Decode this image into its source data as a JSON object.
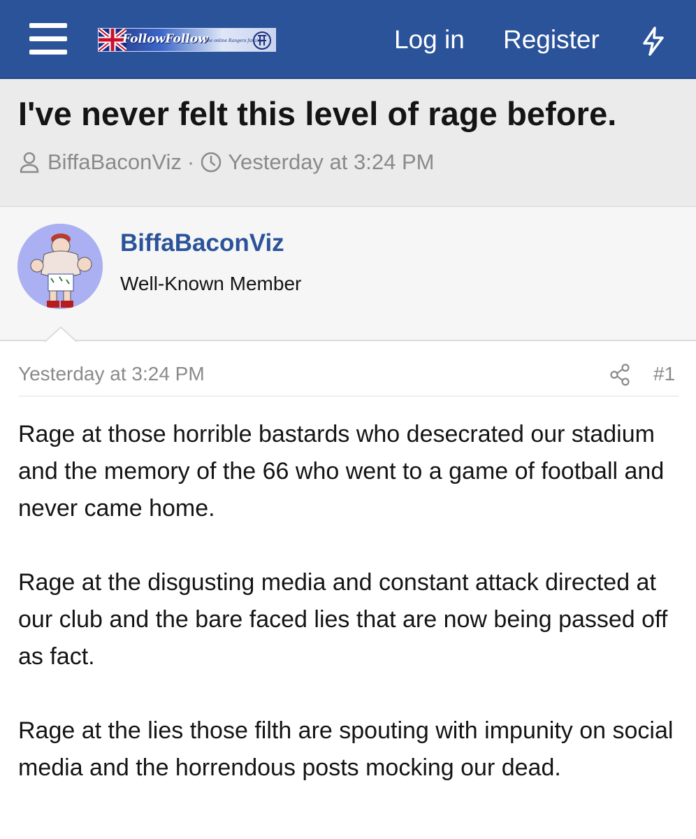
{
  "header": {
    "logo_text": "FollowFollow",
    "logo_tagline": "The online Rangers fanzine",
    "login_label": "Log in",
    "register_label": "Register",
    "icons": [
      "hamburger-menu-icon",
      "bolt-icon"
    ],
    "background_color": "#2b5399"
  },
  "thread": {
    "title": "I've never felt this level of rage before.",
    "author": "BiffaBaconViz",
    "separator": "·",
    "date": "Yesterday at 3:24 PM"
  },
  "author": {
    "name": "BiffaBaconViz",
    "title": "Well-Known Member",
    "name_color": "#2b5399"
  },
  "post": {
    "date": "Yesterday at 3:24 PM",
    "number": "#1",
    "paragraphs": [
      "Rage at those horrible bastards who desecrated our stadium and the memory of the 66 who went to a game of football and never came home.",
      "Rage at the disgusting media and constant attack directed at our club and the bare faced lies that are now being passed off as fact.",
      "Rage at the lies those filth are spouting with impunity on social media and the horrendous posts mocking our dead."
    ]
  }
}
